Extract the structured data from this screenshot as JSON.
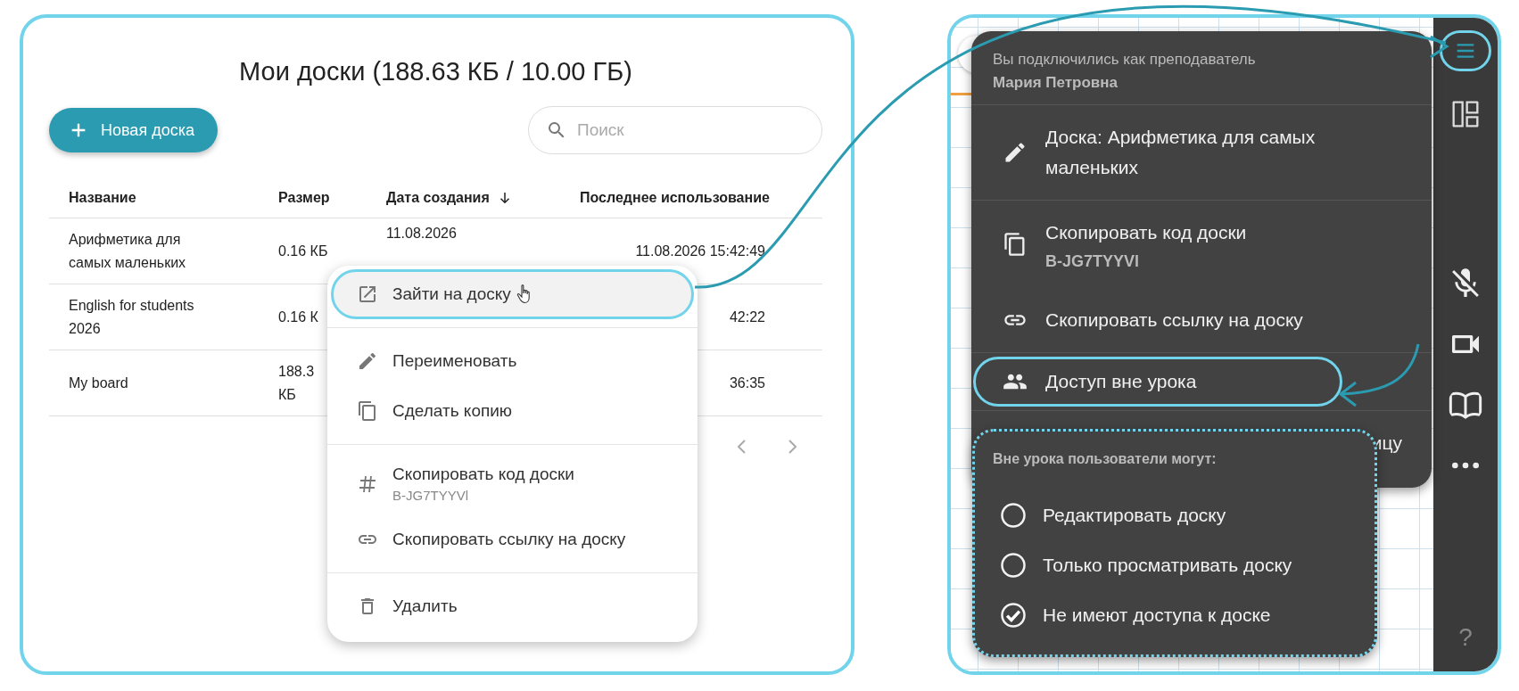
{
  "boards_page": {
    "title": "Мои доски (188.63 КБ / 10.00 ГБ)",
    "new_board_button": "Новая доска",
    "search": {
      "placeholder": "Поиск"
    },
    "table": {
      "columns": [
        {
          "label": "Название",
          "sorted": false
        },
        {
          "label": "Размер",
          "sorted": false
        },
        {
          "label": "Дата создания",
          "sorted": true
        },
        {
          "label": "Последнее использование",
          "sorted": false
        }
      ],
      "rows": [
        {
          "name": "Арифметика для самых маленьких",
          "size": "0.16 КБ",
          "created": "11.08.2026",
          "last_used": "11.08.2026 15:42:49"
        },
        {
          "name": "English for students 2026",
          "size": "0.16 К",
          "last_used": "42:22"
        },
        {
          "name": "My board",
          "size": "188.3 КБ",
          "last_used": "36:35"
        }
      ]
    },
    "context_menu": {
      "groups": [
        [
          {
            "label": "Зайти на доску",
            "hovered": true,
            "highlighted": true
          }
        ],
        [
          {
            "label": "Переименовать",
            "hovered": false,
            "highlighted": false
          },
          {
            "label": "Сделать копию",
            "hovered": false,
            "highlighted": false
          }
        ],
        [
          {
            "label": "Скопировать код доски",
            "code": "B-JG7TYYVl",
            "hovered": false,
            "highlighted": false
          },
          {
            "label": "Скопировать ссылку на доску",
            "hovered": false,
            "highlighted": false
          }
        ],
        [
          {
            "label": "Удалить",
            "hovered": false,
            "highlighted": false
          }
        ]
      ]
    }
  },
  "board_view": {
    "menu": {
      "subtitle": "Вы подключились как преподаватель",
      "user": "Мария Петровна",
      "groups": [
        [
          {
            "label": "Доска: Арифметика для самых маленьких",
            "highlighted": false
          }
        ],
        [
          {
            "label": "Скопировать код доски",
            "code": "B-JG7TYYVl",
            "highlighted": false
          },
          {
            "label": "Скопировать ссылку на доску",
            "highlighted": false
          }
        ],
        [
          {
            "label": "Доступ вне урока",
            "highlighted": true
          }
        ],
        [
          {
            "label": "ицу",
            "highlighted": false
          }
        ]
      ]
    },
    "access_popup": {
      "title": "Вне урока пользователи могут:",
      "options": [
        {
          "label": "Редактировать доску",
          "selected": false
        },
        {
          "label": "Только просматривать доску",
          "selected": false
        },
        {
          "label": "Не имеют доступа к доске",
          "selected": true
        }
      ]
    },
    "sidebar": {
      "items": [
        {
          "kind": "menu",
          "highlighted": true
        },
        {
          "kind": "layout",
          "highlighted": false
        },
        {
          "kind": "mic_off",
          "highlighted": false
        },
        {
          "kind": "video",
          "highlighted": false
        },
        {
          "kind": "book",
          "highlighted": false
        },
        {
          "kind": "more",
          "highlighted": false
        },
        {
          "kind": "help",
          "label": "?",
          "highlighted": false
        }
      ]
    }
  }
}
